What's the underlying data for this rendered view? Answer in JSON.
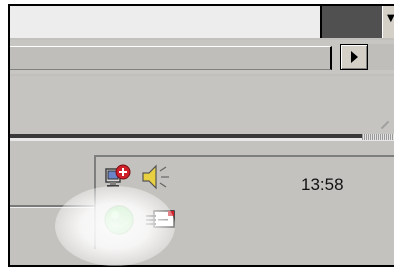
{
  "top_bar": {
    "scroll_arrow": "▼"
  },
  "hscrollbar": {
    "arrow_icon": "right-arrow-icon"
  },
  "tray": {
    "clock": "13:58",
    "icons": [
      {
        "name": "network-connection-icon"
      },
      {
        "name": "volume-speaker-icon"
      },
      {
        "name": "green-status-icon"
      },
      {
        "name": "pc-card-icon"
      }
    ]
  },
  "colors": {
    "window_gray": "#c4c2be",
    "status_green": "#2fc12f",
    "alert_red": "#d0202a",
    "speaker_yellow": "#e8d040"
  }
}
